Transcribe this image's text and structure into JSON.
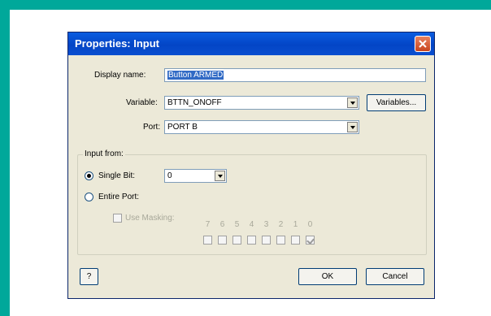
{
  "dialog": {
    "title": "Properties: Input",
    "display_name_label": "Display name:",
    "display_name_value": "Button ARMED",
    "variable_label": "Variable:",
    "variable_value": "BTTN_ONOFF",
    "variables_button": "Variables...",
    "port_label": "Port:",
    "port_value": "PORT B",
    "input_from_label": "Input from:",
    "single_bit_label": "Single Bit:",
    "single_bit_value": "0",
    "entire_port_label": "Entire Port:",
    "use_masking_label": "Use Masking:",
    "bits": [
      {
        "label": "7",
        "checked": false
      },
      {
        "label": "6",
        "checked": false
      },
      {
        "label": "5",
        "checked": false
      },
      {
        "label": "4",
        "checked": false
      },
      {
        "label": "3",
        "checked": false
      },
      {
        "label": "2",
        "checked": false
      },
      {
        "label": "1",
        "checked": false
      },
      {
        "label": "0",
        "checked": true
      }
    ],
    "help_button": "?",
    "ok_button": "OK",
    "cancel_button": "Cancel"
  }
}
